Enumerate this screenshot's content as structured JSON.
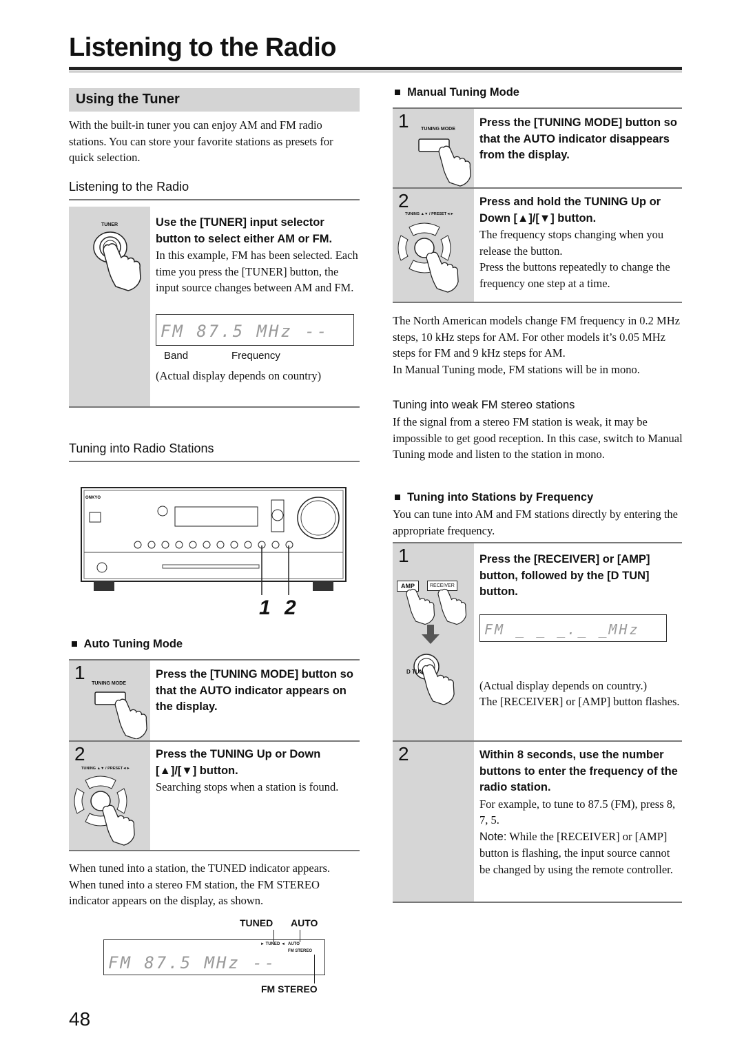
{
  "page": {
    "title": "Listening to the Radio",
    "number": "48"
  },
  "left": {
    "section_title": "Using the Tuner",
    "intro": "With the built-in tuner you can enjoy AM and FM radio stations. You can store your favorite stations as presets for quick selection.",
    "listening": {
      "heading": "Listening to the Radio",
      "button_label": "TUNER",
      "bold": "Use the [TUNER] input selector button to select either AM or FM.",
      "text": "In this example, FM has been selected. Each time you press the [TUNER] button, the input source changes between AM and FM.",
      "display": "FM  87.5 MHz --",
      "band_label": "Band",
      "freq_label": "Frequency",
      "note": "(Actual display depends on country)"
    },
    "tuning": {
      "heading": "Tuning into Radio Stations",
      "callout": "1 2",
      "brand": "ONKYO"
    },
    "auto": {
      "heading": "Auto Tuning Mode",
      "step1": {
        "num": "1",
        "button_label": "TUNING MODE",
        "bold": "Press the [TUNING MODE] button so that the AUTO indicator appears on the display."
      },
      "step2": {
        "num": "2",
        "button_label": "TUNING ▲▼ / PRESET◄►",
        "bold": "Press the TUNING Up or Down [▲]/[▼] button.",
        "text": "Searching stops when a station is found."
      }
    },
    "after": "When tuned into a station, the TUNED indicator appears. When tuned into a stereo FM station, the FM STEREO indicator appears on the display, as shown.",
    "indicator": {
      "tuned": "TUNED",
      "auto": "AUTO",
      "fm_stereo": "FM STEREO",
      "small_tuned": "► TUNED ◄",
      "small_auto": "AUTO",
      "small_stereo": "FM STEREO",
      "display": "FM  87.5 MHz --"
    }
  },
  "right": {
    "manual": {
      "heading": "Manual Tuning Mode",
      "step1": {
        "num": "1",
        "button_label": "TUNING MODE",
        "bold": "Press the [TUNING MODE] button so that the AUTO indicator disappears from the display."
      },
      "step2": {
        "num": "2",
        "button_label": "TUNING ▲▼ / PRESET◄►",
        "bold": "Press and hold the TUNING Up or Down [▲]/[▼] button.",
        "text1": "The frequency stops changing when you release the button.",
        "text2": "Press the buttons repeatedly to change the frequency one step at a time."
      }
    },
    "steps_note": "The North American models change FM frequency in 0.2 MHz steps, 10 kHz steps for AM. For other models it’s 0.05 MHz steps for FM and 9 kHz steps for AM.",
    "mono_note": "In Manual Tuning mode, FM stations will be in mono.",
    "weak": {
      "heading": "Tuning into weak FM stereo stations",
      "text": "If the signal from a stereo FM station is weak, it may be impossible to get good reception. In this case, switch to Manual Tuning mode and listen to the station in mono."
    },
    "freq": {
      "heading": "Tuning into Stations by Frequency",
      "intro": "You can tune into AM and FM stations directly by entering the appropriate frequency.",
      "step1": {
        "num": "1",
        "amp": "AMP",
        "receiver": "RECEIVER",
        "dtun": "D TUN",
        "bold": "Press the [RECEIVER] or [AMP] button, followed by the [D TUN] button.",
        "display": "FM _ _ _._ _MHz",
        "text1": "(Actual display depends on country.)",
        "text2": "The [RECEIVER] or [AMP] button flashes."
      },
      "step2": {
        "num": "2",
        "bold": "Within 8 seconds, use the number buttons to enter the frequency of the radio station.",
        "text": "For example, to tune to 87.5 (FM), press 8, 7, 5.",
        "note_label": "Note:",
        "note": "While the [RECEIVER] or [AMP] button is flashing, the input source cannot be changed by using the remote controller."
      }
    }
  }
}
